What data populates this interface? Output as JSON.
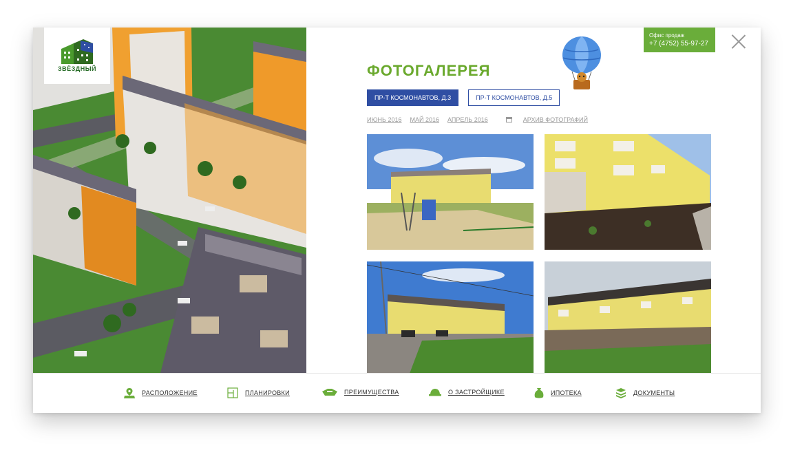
{
  "logo": {
    "text": "ЗВЁЗДНЫЙ"
  },
  "gallery_title": "ФОТОГАЛЕРЕЯ",
  "office": {
    "label": "Офис продаж",
    "phone": "+7 (4752) 55-97-27"
  },
  "tabs": [
    {
      "label": "ПР-Т КОСМОНАВТОВ, Д.3",
      "active": true
    },
    {
      "label": "ПР-Т КОСМОНАВТОВ, Д.5",
      "active": false
    }
  ],
  "months": [
    "ИЮНЬ 2016",
    "МАЙ 2016",
    "АПРЕЛЬ 2016"
  ],
  "archive_label": "АРХИВ ФОТОГРАФИЙ",
  "photos": [
    {
      "icon": "playground-photo"
    },
    {
      "icon": "building-closeup-photo"
    },
    {
      "icon": "building-street-photo"
    },
    {
      "icon": "building-yard-photo"
    }
  ],
  "footer_nav": [
    {
      "label": "РАСПОЛОЖЕНИЕ",
      "icon": "map-pin-icon"
    },
    {
      "label": "ПЛАНИРОВКИ",
      "icon": "floorplan-icon"
    },
    {
      "label": "ПРЕИМУЩЕСТВА",
      "icon": "advantages-icon"
    },
    {
      "label": "О ЗАСТРОЙЩИКЕ",
      "icon": "helmet-icon"
    },
    {
      "label": "ИПОТЕКА",
      "icon": "money-bag-icon"
    },
    {
      "label": "ДОКУМЕНТЫ",
      "icon": "documents-icon"
    }
  ],
  "colors": {
    "accent_green": "#6aa92d",
    "accent_blue": "#2f4ea3",
    "office_bg": "#6aad3a"
  }
}
